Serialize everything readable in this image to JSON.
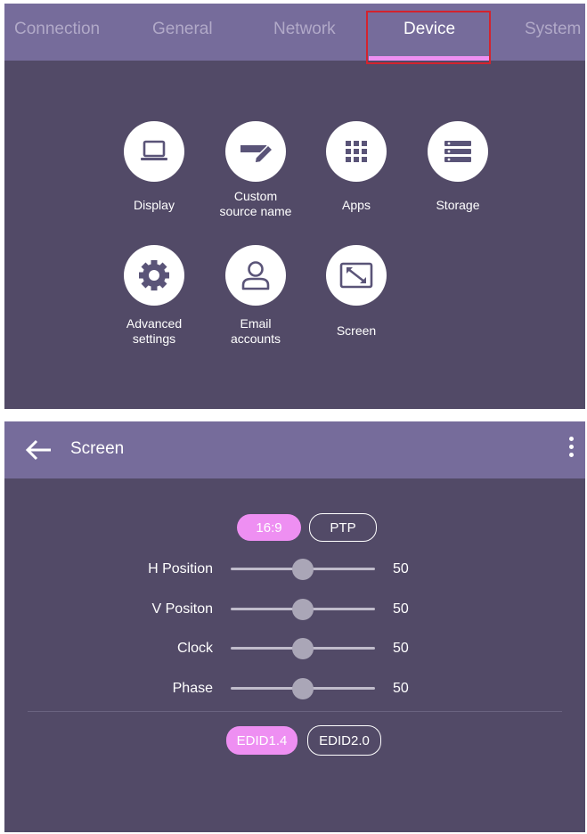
{
  "tabs": [
    {
      "label": "Connection",
      "active": false
    },
    {
      "label": "General",
      "active": false
    },
    {
      "label": "Network",
      "active": false
    },
    {
      "label": "Device",
      "active": true
    },
    {
      "label": "System",
      "active": false
    }
  ],
  "device_tiles": [
    {
      "label": "Display",
      "icon": "laptop-icon"
    },
    {
      "label": "Custom\nsource name",
      "icon": "edit-source-icon"
    },
    {
      "label": "Apps",
      "icon": "apps-grid-icon"
    },
    {
      "label": "Storage",
      "icon": "storage-icon"
    },
    {
      "label": "Advanced\nsettings",
      "icon": "gear-icon"
    },
    {
      "label": "Email\naccounts",
      "icon": "user-icon"
    },
    {
      "label": "Screen",
      "icon": "screen-resize-icon"
    }
  ],
  "screen_panel": {
    "title": "Screen",
    "aspect_options": [
      {
        "label": "16:9",
        "selected": true
      },
      {
        "label": "PTP",
        "selected": false
      }
    ],
    "sliders": [
      {
        "label": "H Position",
        "value": "50"
      },
      {
        "label": "V Positon",
        "value": "50"
      },
      {
        "label": "Clock",
        "value": "50"
      },
      {
        "label": "Phase",
        "value": "50"
      }
    ],
    "edid_options": [
      {
        "label": "EDID1.4",
        "selected": true
      },
      {
        "label": "EDID2.0",
        "selected": false
      }
    ]
  },
  "colors": {
    "background": "#524a67",
    "bar": "#766c9b",
    "accent": "#ee8ff2",
    "highlight_box": "#d3232e",
    "icon": "#5a5478"
  }
}
